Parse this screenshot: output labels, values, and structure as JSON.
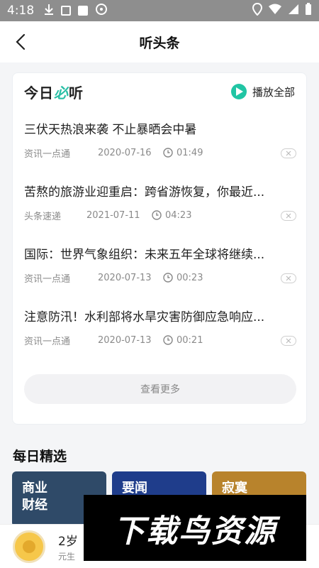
{
  "status_bar": {
    "time": "4:18"
  },
  "header": {
    "title": "听头条"
  },
  "card": {
    "brand_prefix": "今日",
    "brand_accent": "必",
    "brand_suffix": "听",
    "play_all_label": "播放全部",
    "items": [
      {
        "title": "三伏天热浪来袭 不止暴晒会中暑",
        "source": "资讯一点通",
        "date": "2020-07-16",
        "duration": "01:49"
      },
      {
        "title": "苦熬的旅游业迎重启：跨省游恢复，你最近...",
        "source": "头条速递",
        "date": "2021-07-11",
        "duration": "04:23"
      },
      {
        "title": "国际：世界气象组织：未来五年全球将继续...",
        "source": "资讯一点通",
        "date": "2020-07-13",
        "duration": "00:23"
      },
      {
        "title": "注意防汛！水利部将水旱灾害防御应急响应...",
        "source": "资讯一点通",
        "date": "2020-07-13",
        "duration": "00:21"
      }
    ],
    "more_label": "查看更多"
  },
  "daily": {
    "title": "每日精选",
    "cards": [
      {
        "line1": "商业",
        "line2": "财经"
      },
      {
        "line1": "要闻",
        "line2": ""
      },
      {
        "line1": "寂寞",
        "line2": ""
      }
    ]
  },
  "mini_player": {
    "title": "2岁",
    "subtitle": "元生"
  },
  "watermark": {
    "text": "下载鸟资源"
  },
  "colors": {
    "accent": "#21c5a4",
    "status_bar": "#8e8e8e"
  }
}
